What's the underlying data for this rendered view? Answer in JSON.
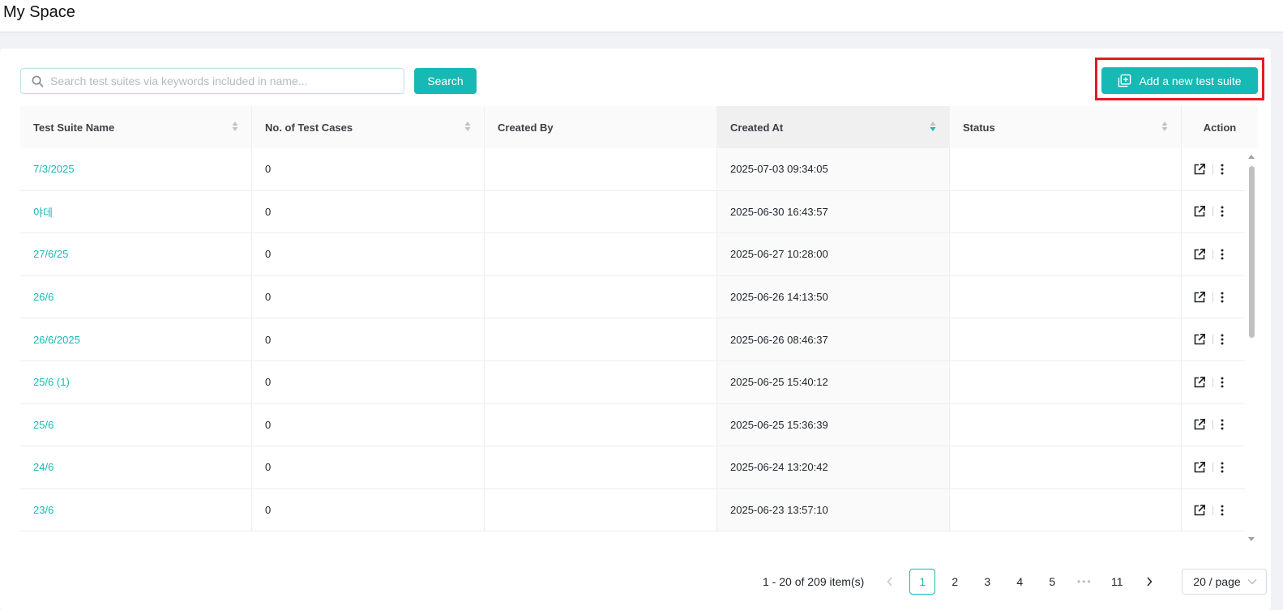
{
  "header": {
    "title": "My Space"
  },
  "toolbar": {
    "search_placeholder": "Search test suites via keywords included in name...",
    "search_label": "Search",
    "add_label": "Add a new test suite"
  },
  "table": {
    "columns": [
      "Test Suite Name",
      "No. of Test Cases",
      "Created By",
      "Created At",
      "Status",
      "Action"
    ],
    "sorted_column": "Created At",
    "rows": [
      {
        "name": "7/3/2025",
        "cases": "0",
        "created_by": "",
        "created_at": "2025-07-03 09:34:05",
        "status": ""
      },
      {
        "name": "야데",
        "cases": "0",
        "created_by": "",
        "created_at": "2025-06-30 16:43:57",
        "status": ""
      },
      {
        "name": "27/6/25",
        "cases": "0",
        "created_by": "",
        "created_at": "2025-06-27 10:28:00",
        "status": ""
      },
      {
        "name": "26/6",
        "cases": "0",
        "created_by": "",
        "created_at": "2025-06-26 14:13:50",
        "status": ""
      },
      {
        "name": "26/6/2025",
        "cases": "0",
        "created_by": "",
        "created_at": "2025-06-26 08:46:37",
        "status": ""
      },
      {
        "name": "25/6 (1)",
        "cases": "0",
        "created_by": "",
        "created_at": "2025-06-25 15:40:12",
        "status": ""
      },
      {
        "name": "25/6",
        "cases": "0",
        "created_by": "",
        "created_at": "2025-06-25 15:36:39",
        "status": ""
      },
      {
        "name": "24/6",
        "cases": "0",
        "created_by": "",
        "created_at": "2025-06-24 13:20:42",
        "status": ""
      },
      {
        "name": "23/6",
        "cases": "0",
        "created_by": "",
        "created_at": "2025-06-23 13:57:10",
        "status": ""
      }
    ]
  },
  "pagination": {
    "total_text": "1 - 20 of 209 item(s)",
    "pages": [
      "1",
      "2",
      "3",
      "4",
      "5"
    ],
    "ellipsis": "•••",
    "last_page": "11",
    "current": "1",
    "page_size": "20 / page"
  },
  "colors": {
    "accent": "#16b9b4",
    "highlight": "#e41b23"
  }
}
